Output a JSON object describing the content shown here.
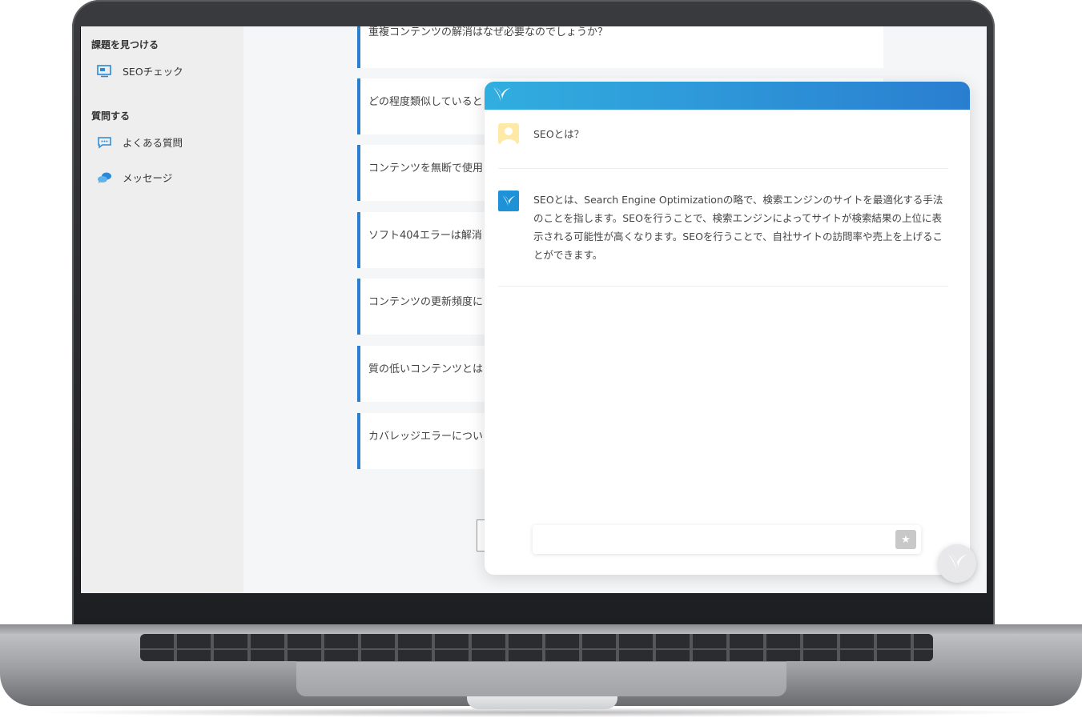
{
  "sidebar": {
    "section_find": "課題を見つける",
    "seo_check": "SEOチェック",
    "section_ask": "質問する",
    "faq": "よくある質問",
    "message": "メッセージ"
  },
  "faq_items": [
    "重複コンテンツの解消はなぜ必要なのでしょうか？",
    "どの程度類似していると",
    "コンテンツを無断で使用",
    "ソフト404エラーは解消",
    "コンテンツの更新頻度に",
    "質の低いコンテンツとは",
    "カバレッジエラーについ"
  ],
  "chat": {
    "user_message": "SEOとは？",
    "bot_message": "SEOとは、Search Engine Optimizationの略で、検索エンジンのサイトを最適化する手法のことを指します。SEOを行うことで、検索エンジンによってサイトが検索結果の上位に表示される可能性が高くなります。SEOを行うことで、自社サイトの訪問率や売上を上げることができます。",
    "input_placeholder": "",
    "send_icon": "★"
  },
  "colors": {
    "accent": "#2a7fd0",
    "header_start": "#31aee0",
    "header_end": "#2a7ed0",
    "sidebar_bg": "#eeeeef",
    "content_bg": "#f5f6f8"
  },
  "icons": {
    "seo_check": "monitor-icon",
    "faq": "speech-bubble-icon",
    "message": "chat-bubbles-icon",
    "brand": "bird-logo-icon",
    "user": "user-avatar-icon",
    "send": "star-icon"
  }
}
